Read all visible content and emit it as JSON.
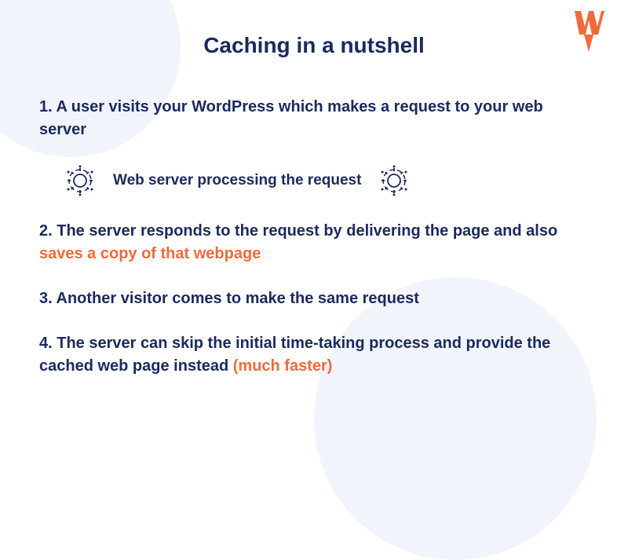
{
  "title": "Caching in a nutshell",
  "step1": "1. A user visits your WordPress which makes a request to your web server",
  "processing_label": "Web server processing the request",
  "step2_prefix": "2. The server responds to the request by delivering the page and also ",
  "step2_highlight": "saves a copy of that webpage",
  "step3": "3. Another visitor comes to make the same request",
  "step4_prefix": "4. The server can skip the initial time-taking process and provide the cached web page instead ",
  "step4_highlight": "(much faster)",
  "colors": {
    "primary": "#1a2a5e",
    "accent": "#f26a3b",
    "bg_circle": "#f2f4fb"
  },
  "logo_name": "wp-rocket-w-logo",
  "icon_name": "gear-processing-icon"
}
